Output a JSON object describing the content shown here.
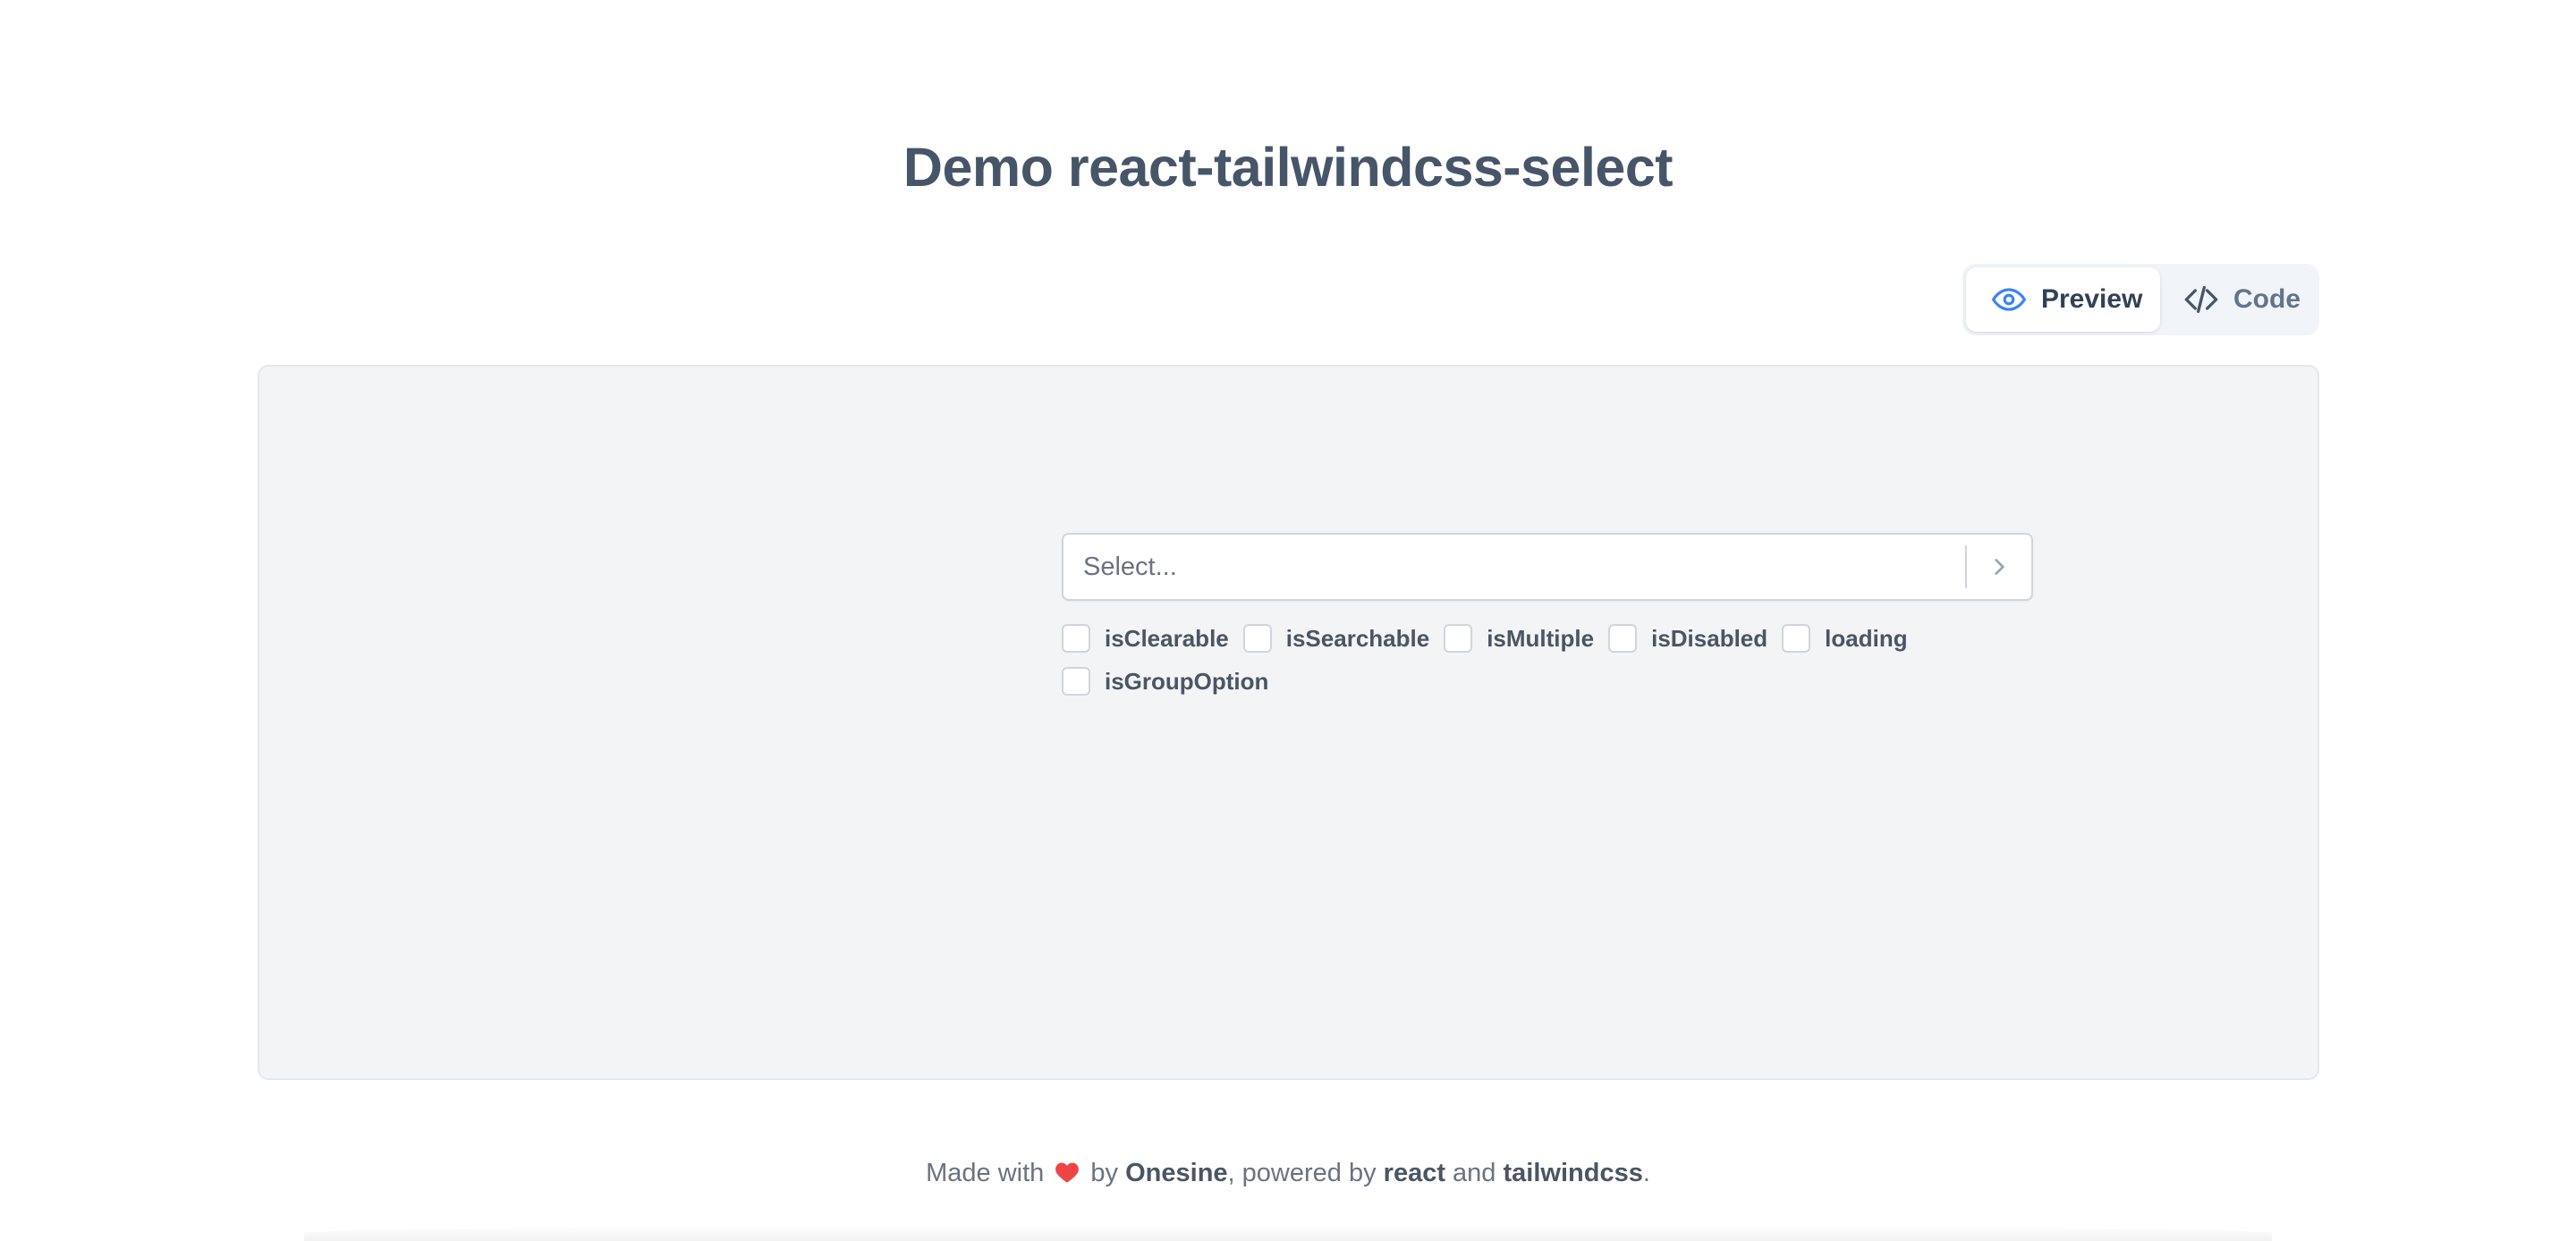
{
  "page": {
    "title": "Demo react-tailwindcss-select"
  },
  "tabs": [
    {
      "label": "Preview",
      "icon": "eye-icon",
      "active": true
    },
    {
      "label": "Code",
      "icon": "code-icon",
      "active": false
    }
  ],
  "select": {
    "placeholder": "Select...",
    "arrow_icon": "chevron-right-icon"
  },
  "options": [
    {
      "label": "isClearable",
      "checked": false
    },
    {
      "label": "isSearchable",
      "checked": false
    },
    {
      "label": "isMultiple",
      "checked": false
    },
    {
      "label": "isDisabled",
      "checked": false
    },
    {
      "label": "loading",
      "checked": false
    },
    {
      "label": "isGroupOption",
      "checked": false
    }
  ],
  "footer": {
    "made_with": "Made with",
    "heart_icon": "heart-icon",
    "by": "by",
    "author": "Onesine",
    "powered_by": ", powered by",
    "tech1": "react",
    "and": "and",
    "tech2": "tailwindcss",
    "end": "."
  },
  "colors": {
    "accent": "#3b82f6",
    "heart": "#ef4444",
    "panel_bg": "#f3f4f6"
  }
}
